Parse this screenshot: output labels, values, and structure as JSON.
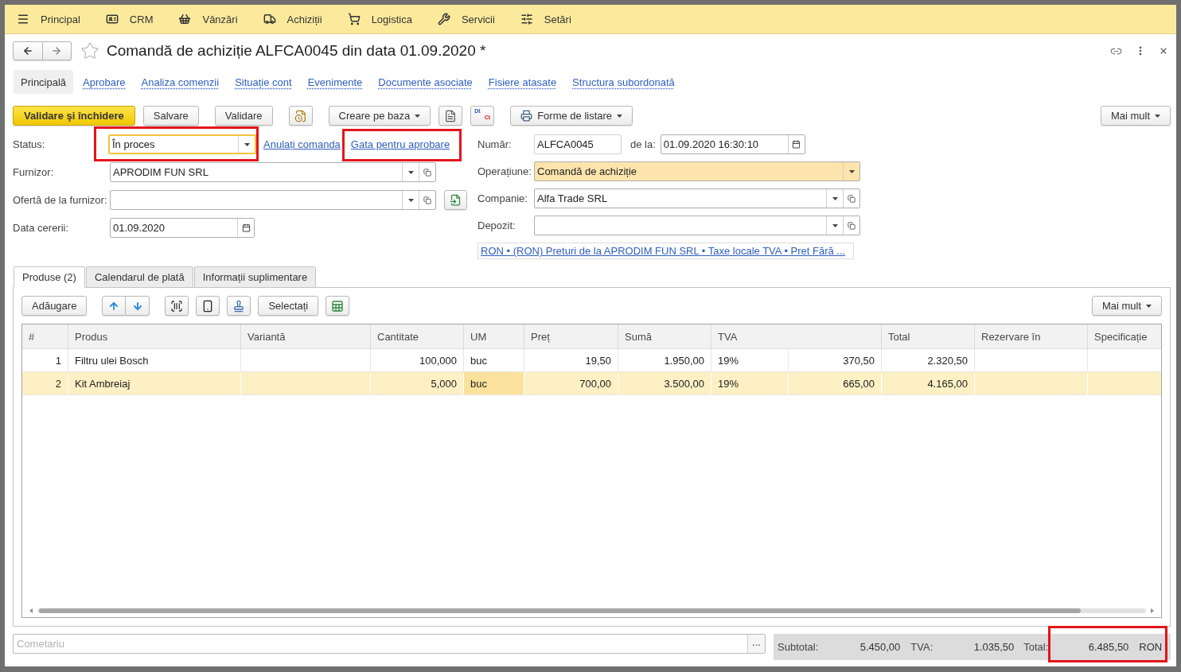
{
  "menu_bar": [
    "Principal",
    "CRM",
    "Vânzări",
    "Achiziții",
    "Logistica",
    "Servicii",
    "Setări"
  ],
  "header": {
    "title": "Comandă de achiziție ALFCA0045 din data 01.09.2020 *",
    "starred": false
  },
  "sections": [
    {
      "label": "Principală",
      "selected": true
    },
    {
      "label": "Aprobare",
      "selected": false
    },
    {
      "label": "Analiza comenzii",
      "selected": false
    },
    {
      "label": "Situație cont",
      "selected": false
    },
    {
      "label": "Evenimente",
      "selected": false
    },
    {
      "label": "Documente asociate",
      "selected": false
    },
    {
      "label": "Fisiere atasate",
      "selected": false
    },
    {
      "label": "Structura subordonată",
      "selected": false
    }
  ],
  "toolbar": {
    "items": [
      {
        "kind": "primary",
        "label": "Validare şi închidere"
      },
      {
        "kind": "button",
        "label": "Salvare"
      },
      {
        "kind": "button",
        "label": "Validare"
      },
      {
        "kind": "icon"
      },
      {
        "kind": "menu",
        "label": "Creare pe baza"
      },
      {
        "kind": "icon"
      },
      {
        "kind": "dtct",
        "label": "Dt",
        "sublabel": "Ct"
      },
      {
        "kind": "print_menu",
        "label": "Forme de listare"
      }
    ],
    "more": "Mai mult"
  },
  "form": {
    "status": {
      "label": "Status:",
      "value": "În proces",
      "focused": true,
      "highlighted": true
    },
    "status_actions": [
      {
        "label": "Anulați comanda",
        "highlighted": false
      },
      {
        "label": "Gata pentru aprobare",
        "highlighted": true
      }
    ],
    "supplier": {
      "label": "Furnizor:",
      "value": "APRODIM FUN SRL"
    },
    "supplier_offer": {
      "label": "Ofertă de la furnizor:"
    },
    "request_date": {
      "label": "Data cererii:",
      "value": "01.09.2020"
    },
    "number": {
      "label": "Număr:",
      "value": "ALFCA0045"
    },
    "date": {
      "label": "de la:",
      "value": "01.09.2020 16:30:10"
    },
    "operation": {
      "label": "Operațiune:",
      "value": "Comandă de achiziție",
      "emphasized": true
    },
    "company": {
      "label": "Companie:",
      "value": "Alfa Trade SRL"
    },
    "warehouse": {
      "label": "Depozit:"
    },
    "price_settings": "RON • (RON) Preturi de la APRODIM FUN SRL • Taxe locale TVA • Pret Fără ..."
  },
  "tabs": [
    {
      "label": "Produse (2)",
      "selected": true
    },
    {
      "label": "Calendarul de plată",
      "selected": false
    },
    {
      "label": "Informații suplimentare",
      "selected": false
    }
  ],
  "table_toolbar": {
    "items": [
      {
        "kind": "button",
        "label": "Adăugare"
      },
      {
        "kind": "move_pair"
      },
      {
        "kind": "icon"
      },
      {
        "kind": "icon"
      },
      {
        "kind": "icon"
      },
      {
        "kind": "button",
        "label": "Selectați"
      },
      {
        "kind": "icon"
      }
    ],
    "more": "Mai mult"
  },
  "table": {
    "columns": [
      "#",
      "Produs",
      "Variantă",
      "Cantitate",
      "UM",
      "Preț",
      "Sumă",
      "TVA",
      "Total",
      "Rezervare în",
      "Specificație"
    ],
    "rows": [
      {
        "number": "1",
        "product": "Filtru ulei Bosch",
        "quantity": "100,000",
        "unit": "buc",
        "price": "19,50",
        "amount": "1.950,00",
        "vat_rate": "19%",
        "vat_amount": "370,50",
        "total": "2.320,50",
        "selected": false,
        "unit_cell_current": false
      },
      {
        "number": "2",
        "product": "Kit Ambreiaj",
        "quantity": "5,000",
        "unit": "buc",
        "price": "700,00",
        "amount": "3.500,00",
        "vat_rate": "19%",
        "vat_amount": "665,00",
        "total": "4.165,00",
        "selected": true,
        "unit_cell_current": true
      }
    ]
  },
  "comment": {
    "placeholder": "Cometariu",
    "button": "..."
  },
  "totals": {
    "subtotal": {
      "label": "Subtotal:",
      "value": "5.450,00",
      "highlighted": false
    },
    "vat": {
      "label": "TVA:",
      "value": "1.035,50",
      "highlighted": false
    },
    "total": {
      "label": "Total:",
      "value": "6.485,50",
      "currency": "RON",
      "highlighted": true
    }
  }
}
